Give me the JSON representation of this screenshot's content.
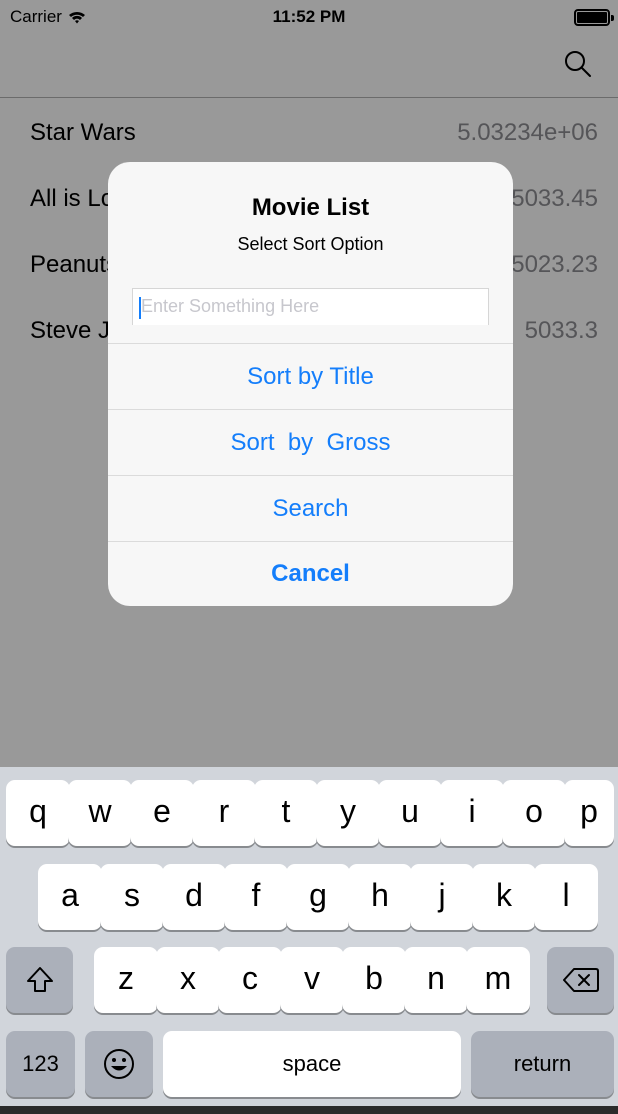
{
  "status_bar": {
    "carrier": "Carrier",
    "time": "11:52 PM"
  },
  "nav_bar": {
    "search_icon": "search-icon"
  },
  "movies": [
    {
      "title": "Star Wars",
      "gross": "5.03234e+06"
    },
    {
      "title": "All is Lo",
      "gross": "5033.45"
    },
    {
      "title": "Peanuts",
      "gross": "5023.23"
    },
    {
      "title": "Steve J",
      "gross": "5033.3"
    }
  ],
  "alert": {
    "title": "Movie List",
    "message": "Select Sort Option",
    "input_placeholder": "Enter Something Here",
    "actions": [
      "Sort by Title",
      "Sort  by  Gross",
      "Search",
      "Cancel"
    ]
  },
  "keyboard": {
    "row1": [
      "q",
      "w",
      "e",
      "r",
      "t",
      "y",
      "u",
      "i",
      "o",
      "p"
    ],
    "row2": [
      "a",
      "s",
      "d",
      "f",
      "g",
      "h",
      "j",
      "k",
      "l"
    ],
    "row3": [
      "z",
      "x",
      "c",
      "v",
      "b",
      "n",
      "m"
    ],
    "numbers_label": "123",
    "space_label": "space",
    "return_label": "return",
    "shift_icon": "shift-icon",
    "delete_icon": "delete-icon",
    "emoji_icon": "emoji-icon"
  },
  "colors": {
    "accent": "#147efb",
    "secondary_text": "#8e8e93",
    "keyboard_bg": "#d1d5db"
  }
}
